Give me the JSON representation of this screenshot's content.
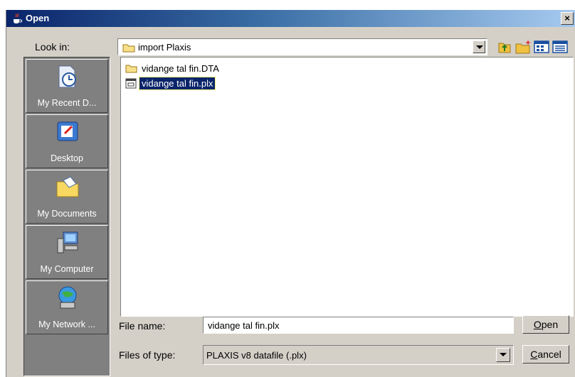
{
  "window": {
    "title": "Open"
  },
  "look_in": {
    "label": "Look in:",
    "value": "import Plaxis"
  },
  "places": [
    {
      "label": "My Recent D...",
      "icon": "recent-documents-icon"
    },
    {
      "label": "Desktop",
      "icon": "desktop-icon"
    },
    {
      "label": "My Documents",
      "icon": "my-documents-icon"
    },
    {
      "label": "My Computer",
      "icon": "my-computer-icon"
    },
    {
      "label": "My Network ...",
      "icon": "network-icon"
    }
  ],
  "files": [
    {
      "name": "vidange tal fin.DTA",
      "type": "folder",
      "selected": false
    },
    {
      "name": "vidange tal fin.plx",
      "type": "file",
      "selected": true
    }
  ],
  "file_name": {
    "label": "File name:",
    "value": "vidange tal fin.plx"
  },
  "file_type": {
    "label": "Files of type:",
    "value": "PLAXIS v8 datafile (.plx)"
  },
  "buttons": {
    "open_mnemonic": "O",
    "open_rest": "pen",
    "cancel_mnemonic": "C",
    "cancel_rest": "ancel"
  },
  "colors": {
    "title_start": "#0a246a",
    "title_end": "#a6caf0",
    "dialog_bg": "#d4d0c8",
    "places_bg": "#808080",
    "selection": "#0a246a"
  }
}
